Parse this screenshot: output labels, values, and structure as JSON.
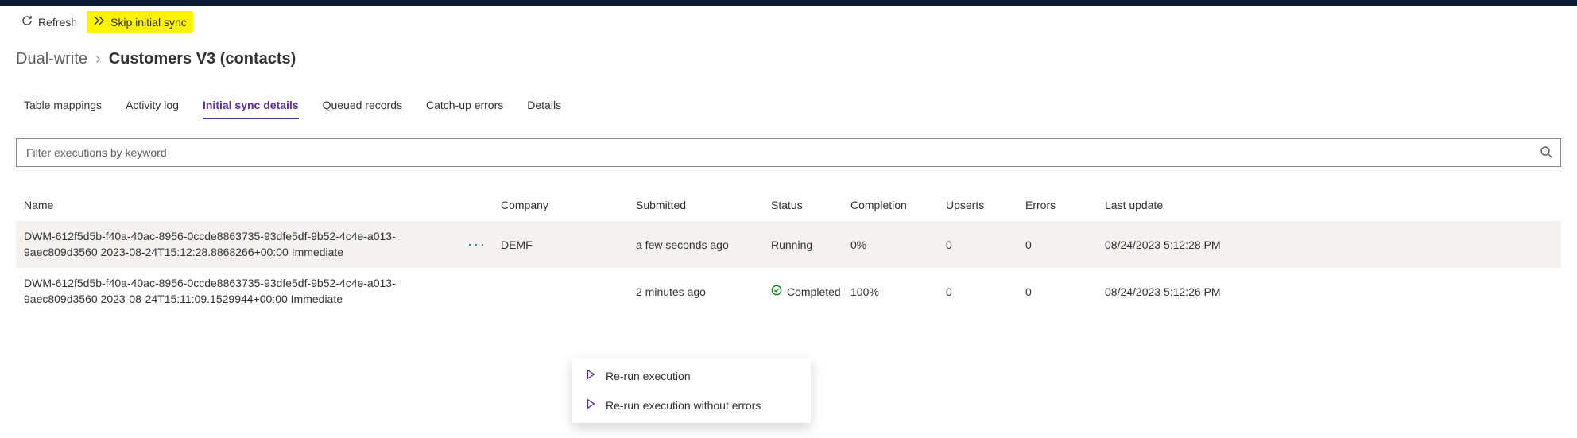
{
  "commands": {
    "refresh": "Refresh",
    "skip": "Skip initial sync"
  },
  "breadcrumb": {
    "parent": "Dual-write",
    "sep": "›",
    "current": "Customers V3 (contacts)"
  },
  "tabs": {
    "table_mappings": "Table mappings",
    "activity_log": "Activity log",
    "initial_sync": "Initial sync details",
    "queued_records": "Queued records",
    "catchup_errors": "Catch-up errors",
    "details": "Details"
  },
  "filter": {
    "placeholder": "Filter executions by keyword"
  },
  "columns": {
    "name": "Name",
    "company": "Company",
    "submitted": "Submitted",
    "status": "Status",
    "completion": "Completion",
    "upserts": "Upserts",
    "errors": "Errors",
    "last_update": "Last update"
  },
  "rows": [
    {
      "name": "DWM-612f5d5b-f40a-40ac-8956-0ccde8863735-93dfe5df-9b52-4c4e-a013-9aec809d3560 2023-08-24T15:12:28.8868266+00:00 Immediate",
      "company": "DEMF",
      "submitted": "a few seconds ago",
      "status": "Running",
      "completion": "0%",
      "upserts": "0",
      "errors": "0",
      "last_update": "08/24/2023 5:12:28 PM",
      "status_icon": "none"
    },
    {
      "name": "DWM-612f5d5b-f40a-40ac-8956-0ccde8863735-93dfe5df-9b52-4c4e-a013-9aec809d3560 2023-08-24T15:11:09.1529944+00:00 Immediate",
      "company": "",
      "submitted": "2 minutes ago",
      "status": "Completed",
      "completion": "100%",
      "upserts": "0",
      "errors": "0",
      "last_update": "08/24/2023 5:12:26 PM",
      "status_icon": "check"
    }
  ],
  "menu": {
    "rerun": "Re-run execution",
    "rerun_no_errors": "Re-run execution without errors"
  }
}
